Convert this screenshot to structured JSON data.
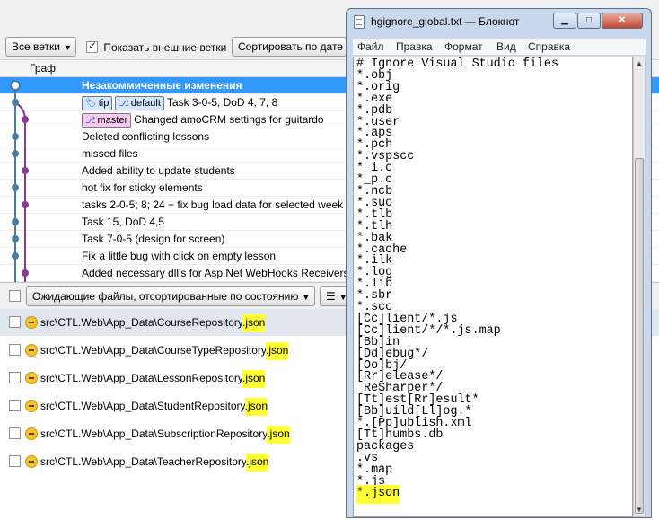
{
  "toolbar": {
    "all_branches": "Все ветки",
    "show_remote": "Показать внешние ветки",
    "show_remote_checked": true,
    "sort_by_date": "Сортировать по дате"
  },
  "graph_header": {
    "label": "Граф"
  },
  "commits": [
    {
      "message": "Незакоммиченные изменения",
      "selected": true,
      "tags": []
    },
    {
      "message": "Task 3-0-5, DoD 4, 7, 8",
      "tags": [
        "tip",
        "default"
      ]
    },
    {
      "message": "Changed amoCRM settings for guitardo",
      "tags": [
        "master"
      ]
    },
    {
      "message": "Deleted conflicting lessons",
      "tags": []
    },
    {
      "message": "missed files",
      "tags": []
    },
    {
      "message": "Added ability to update students",
      "tags": []
    },
    {
      "message": "hot fix for sticky elements",
      "tags": []
    },
    {
      "message": "tasks 2-0-5; 8; 24 + fix bug load data for selected week",
      "tags": []
    },
    {
      "message": "Task 15, DoD 4,5",
      "tags": []
    },
    {
      "message": "Task 7-0-5 (design for screen)",
      "tags": []
    },
    {
      "message": "Fix a little bug with click on empty lesson",
      "tags": []
    },
    {
      "message": "Added necessary dll's for Asp.Net WebHooks Receivers",
      "tags": []
    }
  ],
  "filter": {
    "pending_label": "Ожидающие файлы, отсортированные по состоянию"
  },
  "files": [
    {
      "path_prefix": "src\\CTL.Web\\App_Data\\CourseRepository",
      "ext": ".json"
    },
    {
      "path_prefix": "src\\CTL.Web\\App_Data\\CourseTypeRepository",
      "ext": ".json"
    },
    {
      "path_prefix": "src\\CTL.Web\\App_Data\\LessonRepository",
      "ext": ".json"
    },
    {
      "path_prefix": "src\\CTL.Web\\App_Data\\StudentRepository",
      "ext": ".json"
    },
    {
      "path_prefix": "src\\CTL.Web\\App_Data\\SubscriptionRepository",
      "ext": ".json"
    },
    {
      "path_prefix": "src\\CTL.Web\\App_Data\\TeacherRepository",
      "ext": ".json"
    }
  ],
  "notepad": {
    "title": "hgignore_global.txt — Блокнот",
    "menu": [
      "Файл",
      "Правка",
      "Формат",
      "Вид",
      "Справка"
    ],
    "lines": [
      "# Ignore Visual Studio files",
      "*.obj",
      "*.orig",
      "*.exe",
      "*.pdb",
      "*.user",
      "*.aps",
      "*.pch",
      "*.vspscc",
      "*_i.c",
      "*_p.c",
      "*.ncb",
      "*.suo",
      "*.tlb",
      "*.tlh",
      "*.bak",
      "*.cache",
      "*.ilk",
      "*.log",
      "*.lib",
      "*.sbr",
      "*.scc",
      "[Cc]lient/*.js",
      "[Cc]lient/*/*.js.map",
      "[Bb]in",
      "[Dd]ebug*/",
      "[Oo]bj/",
      "[Rr]elease*/",
      "_ReSharper*/",
      "[Tt]est[Rr]esult*",
      "[Bb]uild[Ll]og.*",
      "*.[Pp]ublish.xml",
      "[Tt]humbs.db",
      "packages",
      ".vs",
      "*.map",
      "*.js"
    ],
    "highlighted_last_line": "*.json"
  },
  "colors": {
    "selection": "#3399ff",
    "highlight": "#ffff33",
    "tag_blue": "#d3e7ff",
    "tag_pink": "#f9c9f3"
  }
}
